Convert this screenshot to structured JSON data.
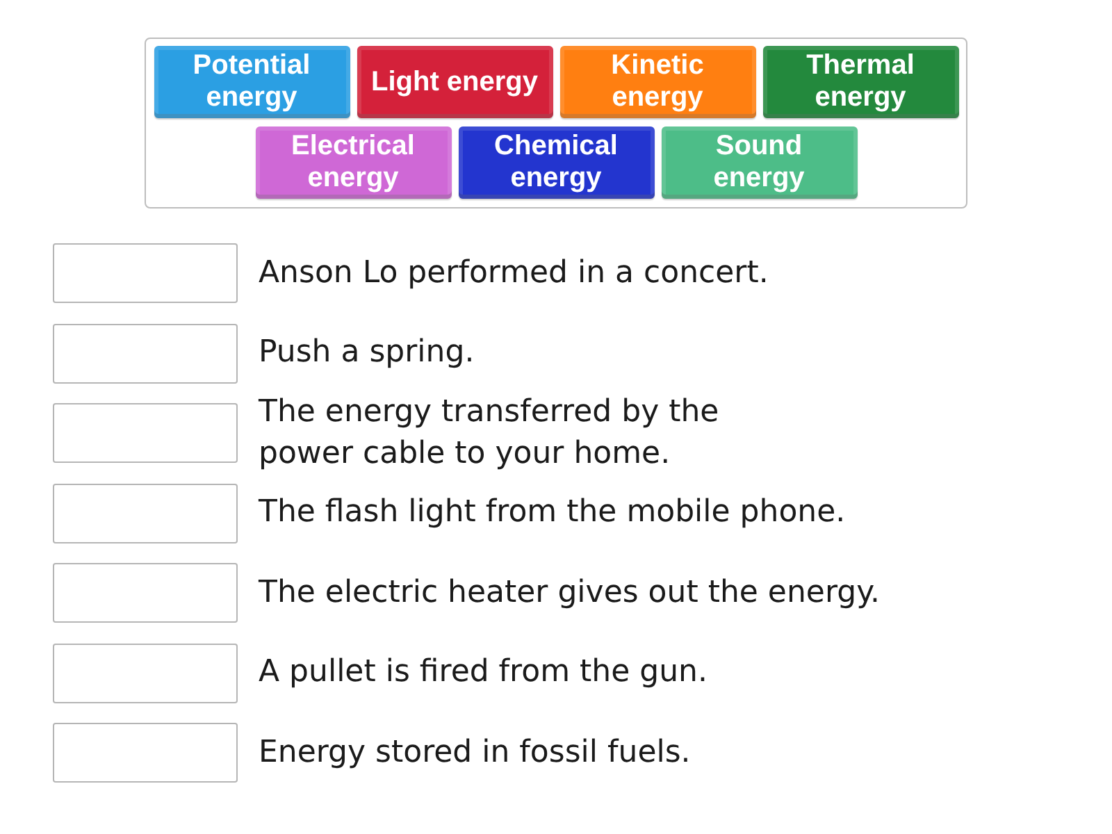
{
  "tile_bank": {
    "tiles": [
      {
        "label": "Potential energy",
        "color": "#2b9fe3"
      },
      {
        "label": "Light energy",
        "color": "#d4213a"
      },
      {
        "label": "Kinetic energy",
        "color": "#ff7f11"
      },
      {
        "label": "Thermal energy",
        "color": "#23893d"
      },
      {
        "label": "Electrical energy",
        "color": "#cf68d6"
      },
      {
        "label": "Chemical energy",
        "color": "#2335cf"
      },
      {
        "label": "Sound energy",
        "color": "#4dbd88"
      }
    ]
  },
  "questions": [
    {
      "text": "Anson Lo performed in a concert."
    },
    {
      "text": "Push a spring."
    },
    {
      "text": "The energy transferred by the\npower cable to your home."
    },
    {
      "text": "The flash light from the mobile phone."
    },
    {
      "text": "The electric heater gives out the energy."
    },
    {
      "text": "A pullet is fired from the gun."
    },
    {
      "text": "Energy stored in fossil fuels."
    }
  ]
}
